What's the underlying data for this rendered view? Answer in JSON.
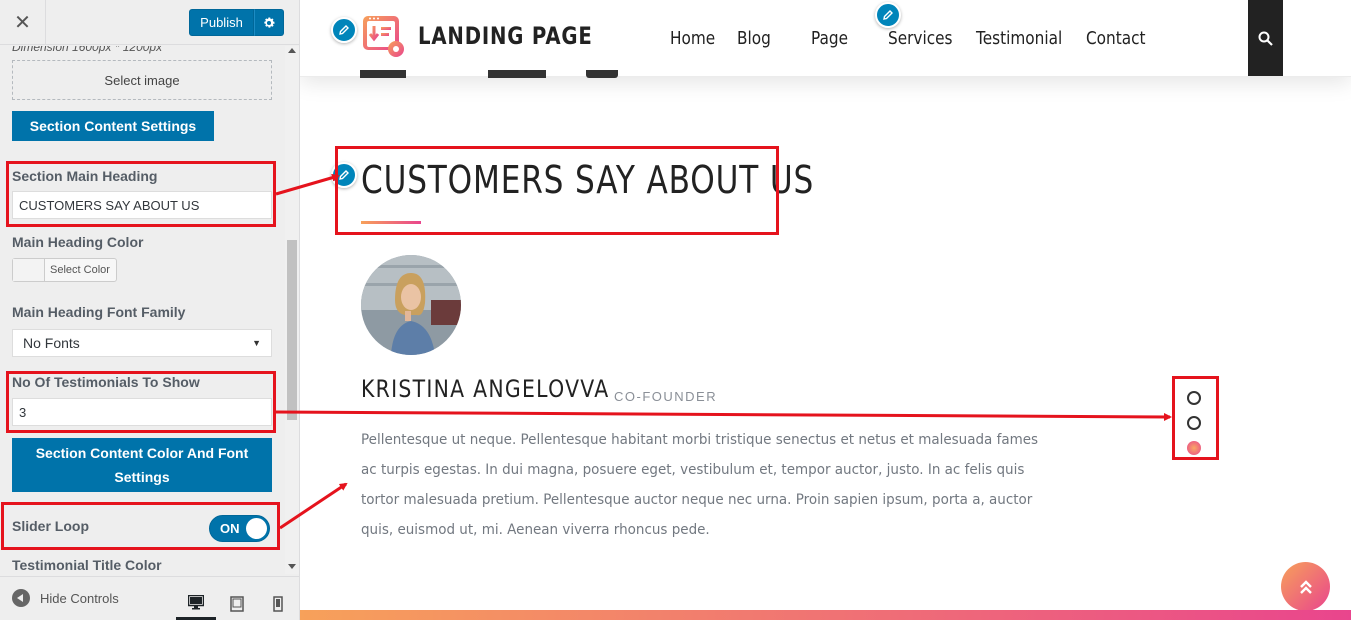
{
  "sidebar": {
    "publish_label": "Publish",
    "dimension_note": "Dimension 1600px * 1200px",
    "select_image_label": "Select image",
    "section_content_settings_label": "Section Content Settings",
    "main_heading_label": "Section Main Heading",
    "main_heading_value": "CUSTOMERS SAY ABOUT US",
    "main_heading_color_label": "Main Heading Color",
    "select_color_label": "Select Color",
    "font_family_label": "Main Heading Font Family",
    "font_family_value": "No Fonts",
    "testimonials_count_label": "No Of Testimonials To Show",
    "testimonials_count_value": "3",
    "color_font_settings_label": "Section Content Color And Font Settings",
    "slider_loop_label": "Slider Loop",
    "slider_loop_state": "ON",
    "testimonial_title_color_label": "Testimonial Title Color",
    "hide_controls_label": "Hide Controls"
  },
  "site": {
    "logo_text": "LANDING PAGE",
    "nav": [
      "Home",
      "Blog",
      "Page",
      "Services",
      "Testimonial",
      "Contact"
    ]
  },
  "testimonials": {
    "heading": "CUSTOMERS SAY ABOUT US",
    "name": "KRISTINA ANGELOVVA",
    "role": "CO-FOUNDER",
    "quote": "Pellentesque ut neque. Pellentesque habitant morbi tristique senectus et netus et malesuada fames ac turpis egestas. In dui magna, posuere eget, vestibulum et, tempor auctor, justo. In ac felis quis tortor malesuada pretium. Pellentesque auctor neque nec urna. Proin sapien ipsum, porta a, auctor quis, euismod ut, mi. Aenean viverra rhoncus pede.",
    "pagination_count": 3,
    "active_dot": 3
  },
  "colors": {
    "wp_blue": "#0073aa",
    "annotation_red": "#e5131d",
    "gradient_start": "#f7a15a",
    "gradient_end": "#e9458d"
  },
  "icons": [
    "close-icon",
    "gear-icon",
    "pencil-icon",
    "search-icon",
    "chevron-down-icon",
    "arrow-left-circle-icon",
    "desktop-icon",
    "tablet-icon",
    "mobile-icon",
    "double-chevron-up-icon"
  ]
}
